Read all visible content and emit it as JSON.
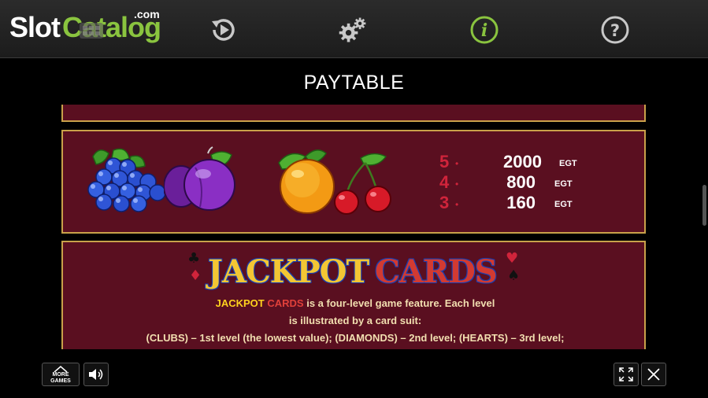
{
  "brand": {
    "slot": "Slot",
    "catalog": "Catalog",
    "com": ".com"
  },
  "toolbar": {
    "icons": [
      "game-grid-icon",
      "autoplay-icon",
      "settings-gear-icon",
      "info-icon",
      "help-icon"
    ]
  },
  "paytable": {
    "title": "PAYTABLE",
    "fruit_pays": [
      {
        "count": "5",
        "amount": "2000",
        "unit": "EGT"
      },
      {
        "count": "4",
        "amount": "800",
        "unit": "EGT"
      },
      {
        "count": "3",
        "amount": "160",
        "unit": "EGT"
      }
    ],
    "jackpot": {
      "title_jackpot": "JACKPOT",
      "title_cards": "CARDS",
      "line1_jackpot": "JACKPOT",
      "line1_cards": "CARDS",
      "line1_rest": " is a four-level game feature. Each level",
      "line2": "is illustrated by a card suit:",
      "line3": "(CLUBS) – 1st level (the lowest value); (DIAMONDS) – 2nd level; (HEARTS) – 3rd level;"
    }
  },
  "bottom": {
    "more_games_line1": "MORE",
    "more_games_line2": "GAMES"
  },
  "colors": {
    "panel_bg": "#5a0f20",
    "panel_border": "#c9a14a",
    "brand_green": "#8ac43f",
    "pay_count_red": "#d0243b",
    "info_active_green": "#8ac43f"
  }
}
